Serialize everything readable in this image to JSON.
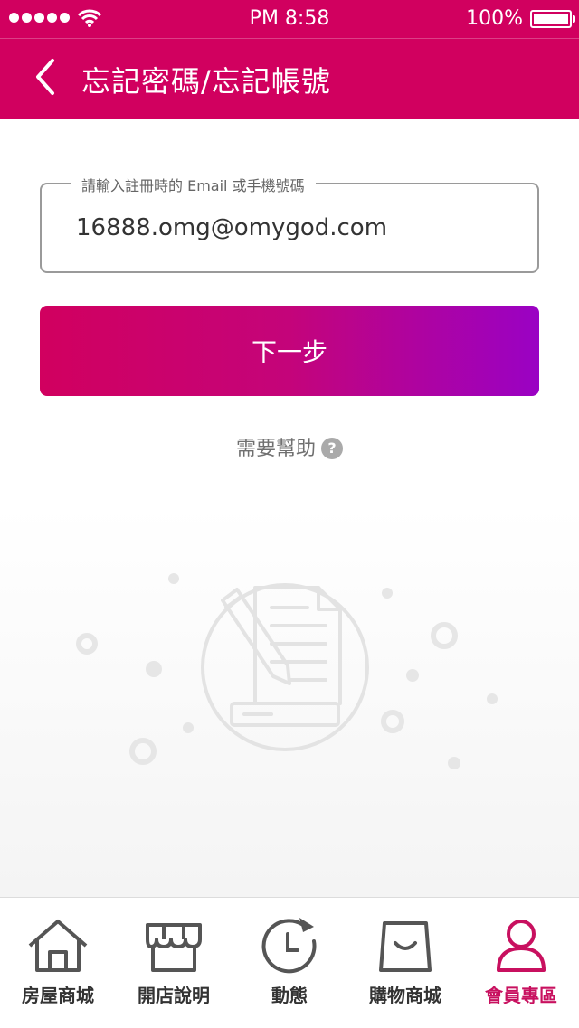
{
  "status_bar": {
    "time": "PM 8:58",
    "battery": "100%"
  },
  "header": {
    "title": "忘記密碼/忘記帳號"
  },
  "form": {
    "field_label": "請輸入註冊時的 Email 或手機號碼",
    "field_value": "16888.omg@omygod.com",
    "next_button": "下一步",
    "help_text": "需要幫助",
    "help_icon": "?"
  },
  "colors": {
    "brand": "#d1005f",
    "gradient_end": "#9a02c4",
    "active_tab": "#c8105f"
  },
  "tabs": [
    {
      "label": "房屋商城",
      "icon": "house-icon",
      "active": false
    },
    {
      "label": "開店說明",
      "icon": "storefront-icon",
      "active": false
    },
    {
      "label": "動態",
      "icon": "clock-refresh-icon",
      "active": false
    },
    {
      "label": "購物商城",
      "icon": "shopping-bag-icon",
      "active": false
    },
    {
      "label": "會員專區",
      "icon": "user-icon",
      "active": true
    }
  ]
}
